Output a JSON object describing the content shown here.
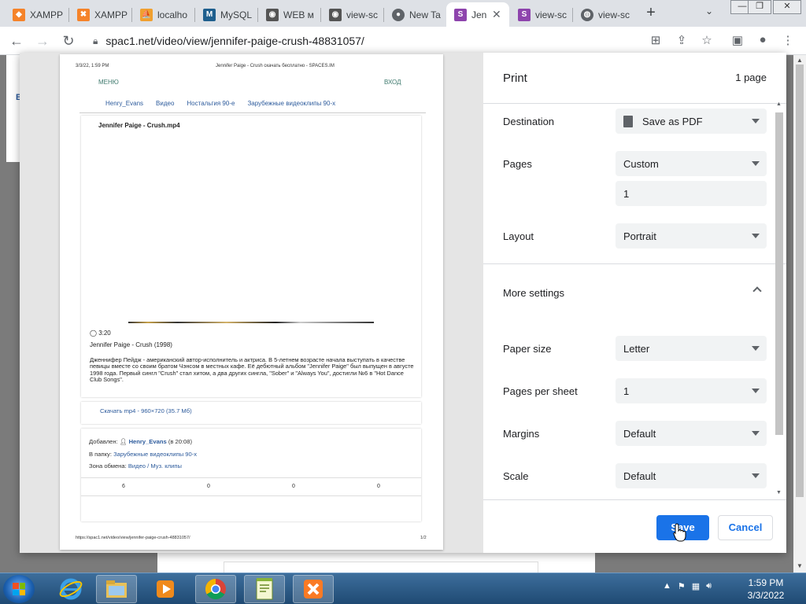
{
  "browser": {
    "tabs": [
      {
        "label": "XAMPP",
        "icon": "xampp-icon",
        "color": "#f5832a"
      },
      {
        "label": "XAMPP",
        "icon": "xampp-icon",
        "color": "#f5832a"
      },
      {
        "label": "localho",
        "icon": "phpmyadmin-icon",
        "color": "#f0a030"
      },
      {
        "label": "MySQL",
        "icon": "mysql-icon",
        "color": "#1f5f8e"
      },
      {
        "label": "WEB м",
        "icon": "eye-icon",
        "color": "#555555"
      },
      {
        "label": "view-sc",
        "icon": "eye-icon",
        "color": "#555555"
      },
      {
        "label": "New Ta",
        "icon": "chrome-icon",
        "color": "#5f6368"
      },
      {
        "label": "Jen",
        "icon": "spaces-icon",
        "color": "#8e44ad",
        "active": true
      },
      {
        "label": "view-sc",
        "icon": "spaces-icon",
        "color": "#8e44ad"
      },
      {
        "label": "view-sc",
        "icon": "globe-icon",
        "color": "#5f6368"
      }
    ],
    "new_tab": "+",
    "url": "spac1.net/video/view/jennifer-paige-crush-48831057/"
  },
  "preview": {
    "header_date": "3/3/22, 1:59 PM",
    "header_title": "Jennifer Paige - Crush скачать бесплатно - SPACES.IM",
    "menu": "МЕНЮ",
    "login": "ВХОД",
    "crumbs": [
      "Henry_Evans",
      "Видео",
      "Ностальгия 90-е",
      "Зарубежные видеоклипы 90-х"
    ],
    "video_title": "Jennifer Paige - Crush.mp4",
    "duration": "3:20",
    "subtitle": "Jennifer Paige - Crush (1998)",
    "description": "Дженнифер Пейдж - американский автор-исполнитель и актриса. В 5-летнем возрасте начала выступать в качестве певицы вместе со своим братом Чэнсом в местных кафе. Её дебютный альбом \"Jennifer Paige\" был выпущен в августе 1998 года. Первый сингл \"Crush\" стал хитом, а два других сингла, \"Sober\" и \"Always You\", достигли №6 в \"Hot Dance Club Songs\".",
    "download": "Скачать mp4 - 960×720 (35.7 Мб)",
    "added_label": "Добавлен:",
    "added_user": "Henry_Evans",
    "added_time": "(в 20:08)",
    "folder_label": "В папку:",
    "folder_link": "Зарубежные видеоклипы 90-х",
    "zone_label": "Зона обмена:",
    "zone_link": "Видео / Муз. клипы",
    "stats": [
      "6",
      "0",
      "0",
      "0"
    ],
    "footer_url": "https://spac1.net/video/view/jennifer-paige-crush-48831057/",
    "footer_page": "1/2"
  },
  "print": {
    "title": "Print",
    "page_count": "1 page",
    "destination_label": "Destination",
    "destination_value": "Save as PDF",
    "pages_label": "Pages",
    "pages_value": "Custom",
    "pages_custom": "1",
    "layout_label": "Layout",
    "layout_value": "Portrait",
    "more_settings": "More settings",
    "paper_size_label": "Paper size",
    "paper_size_value": "Letter",
    "pps_label": "Pages per sheet",
    "pps_value": "1",
    "margins_label": "Margins",
    "margins_value": "Default",
    "scale_label": "Scale",
    "scale_value": "Default",
    "save": "Save",
    "cancel": "Cancel"
  },
  "taskbar": {
    "time": "1:59 PM",
    "date": "3/3/2022",
    "apps": [
      "internet-explorer-icon",
      "file-explorer-icon",
      "media-player-icon",
      "chrome-icon",
      "notepad-plus-plus-icon",
      "xampp-icon"
    ]
  },
  "colors": {
    "accent": "#1a73e8",
    "link": "#2d5b9c",
    "taskbar": "#2b5a87"
  }
}
